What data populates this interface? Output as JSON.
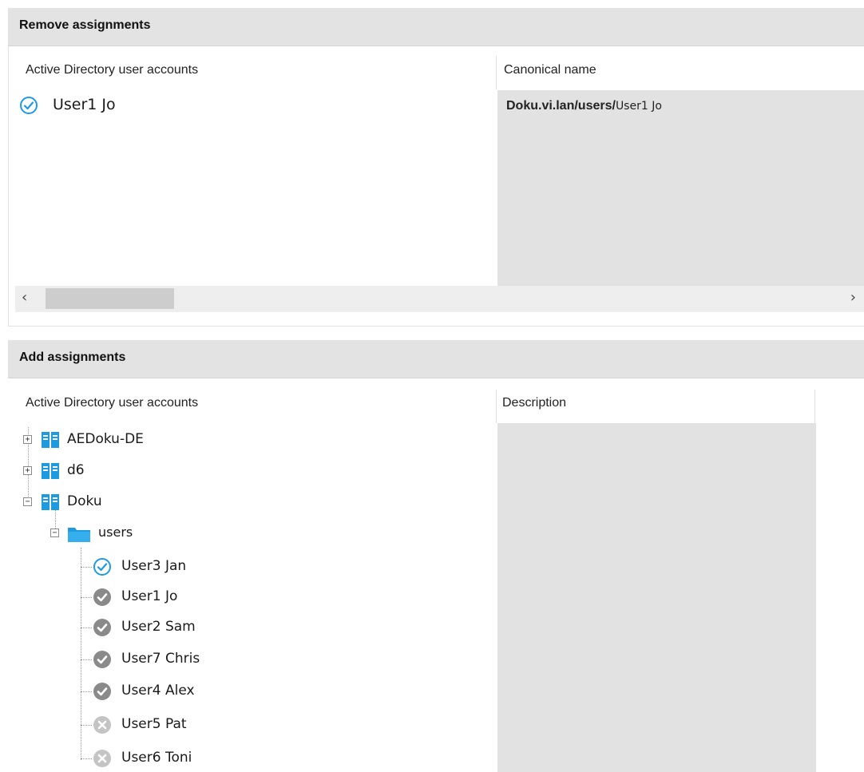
{
  "remove": {
    "title": "Remove assignments",
    "col1_header": "Active Directory user accounts",
    "col2_header": "Canonical name",
    "rows": [
      {
        "name": "User1 Jo",
        "canonical_prefix": "Doku.vi.lan/users/",
        "canonical_suffix": "User1 Jo",
        "icon": "checked-circle-icon"
      }
    ],
    "scroll_left": "‹",
    "scroll_right": "›"
  },
  "add": {
    "title": "Add assignments",
    "col1_header": "Active Directory user accounts",
    "col2_header": "Description",
    "tree": {
      "domains": [
        {
          "label": "AEDoku-DE",
          "expander": "+",
          "icon": "domain-icon"
        },
        {
          "label": "d6",
          "expander": "+",
          "icon": "domain-icon"
        },
        {
          "label": "Doku",
          "expander": "−",
          "icon": "domain-icon"
        }
      ],
      "folder": {
        "label": "users",
        "expander": "−",
        "icon": "folder-icon"
      },
      "users": [
        {
          "label": "User3 Jan",
          "status": "selected",
          "icon": "checked-circle-icon"
        },
        {
          "label": "User1 Jo",
          "status": "assigned",
          "icon": "grey-check-icon"
        },
        {
          "label": "User2 Sam",
          "status": "assigned",
          "icon": "grey-check-icon"
        },
        {
          "label": "User7 Chris",
          "status": "assigned",
          "icon": "grey-check-icon"
        },
        {
          "label": "User4 Alex",
          "status": "assigned",
          "icon": "grey-check-icon"
        },
        {
          "label": "User5 Pat",
          "status": "unavailable",
          "icon": "grey-cross-icon"
        },
        {
          "label": "User6 Toni",
          "status": "unavailable",
          "icon": "grey-cross-icon"
        }
      ]
    }
  },
  "colors": {
    "accent": "#1e9be0",
    "header_bg": "#e3e3e3",
    "grey_column": "#e2e2e2",
    "assigned_icon": "#8a8a8a",
    "unavailable_icon": "#c4c4c4"
  }
}
